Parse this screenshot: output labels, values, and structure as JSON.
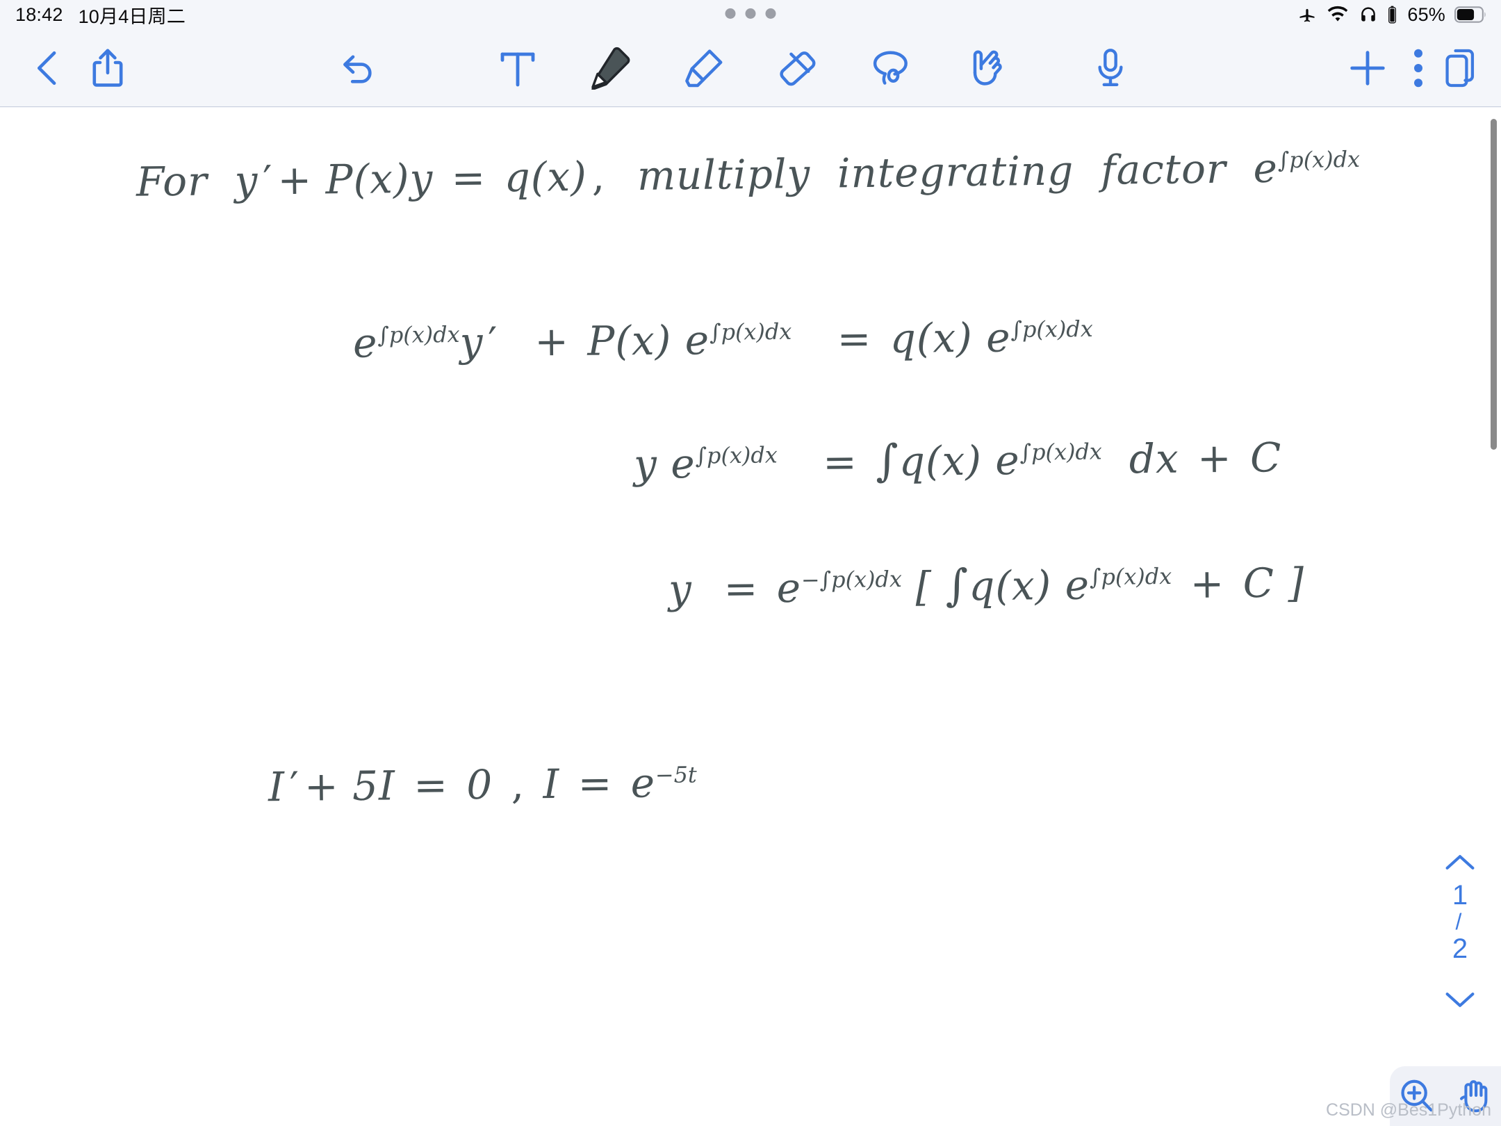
{
  "status_bar": {
    "time": "18:42",
    "date": "10月4日周二",
    "battery_percent": "65%",
    "icons": [
      "airplane-mode-icon",
      "wifi-icon",
      "headphones-icon",
      "headphones-battery-icon",
      "battery-icon"
    ],
    "multitask_handle": "multitask-handle-icon"
  },
  "toolbar": {
    "back_label": "back-chevron-icon",
    "share_label": "share-icon",
    "undo_label": "undo-icon",
    "tools": [
      {
        "name": "text-tool",
        "icon": "text-T-icon",
        "selected": false
      },
      {
        "name": "pen-tool",
        "icon": "pen-icon",
        "selected": true
      },
      {
        "name": "highlighter-tool",
        "icon": "highlighter-icon",
        "selected": false
      },
      {
        "name": "eraser-tool",
        "icon": "eraser-icon",
        "selected": false
      },
      {
        "name": "lasso-tool",
        "icon": "lasso-icon",
        "selected": false
      },
      {
        "name": "shape-hand-tool",
        "icon": "pointing-hand-icon",
        "selected": false
      }
    ],
    "mic_label": "microphone-icon",
    "add_label": "plus-icon",
    "more_label": "three-dot-menu-icon",
    "pages_label": "pages-copy-icon"
  },
  "notes": {
    "ink_color": "#4a5457",
    "accent_color": "#3d7ae0",
    "lines": [
      {
        "id": "line-1",
        "text": "For  y' + P(x)y = q(x) ,  multiply  integrating  factor  e^∫p(x)dx"
      },
      {
        "id": "line-2",
        "text": "e^∫p(x)dx y'  +  P(x) e^∫p(x)dx  =  q(x) e^∫p(x)dx"
      },
      {
        "id": "line-3",
        "text": "y e^∫p(x)dx  =  ∫ q(x) e^∫p(x)dx  dx + C"
      },
      {
        "id": "line-4",
        "text": "y  =  e^-∫p(x)dx [ ∫ q(x) e^∫p(x)dx + C ]"
      },
      {
        "id": "line-5",
        "text": "I' + 5I = 0 ,  I = e^-5t"
      }
    ]
  },
  "page_nav": {
    "up_label": "chevron-up-icon",
    "current_page": "1",
    "separator": "/",
    "total_pages": "2",
    "down_label": "chevron-down-icon"
  },
  "zoom_panel": {
    "zoom_in_label": "zoom-in-magnifier-icon",
    "pan_label": "open-hand-icon"
  },
  "watermark": "CSDN @Bes1Python"
}
